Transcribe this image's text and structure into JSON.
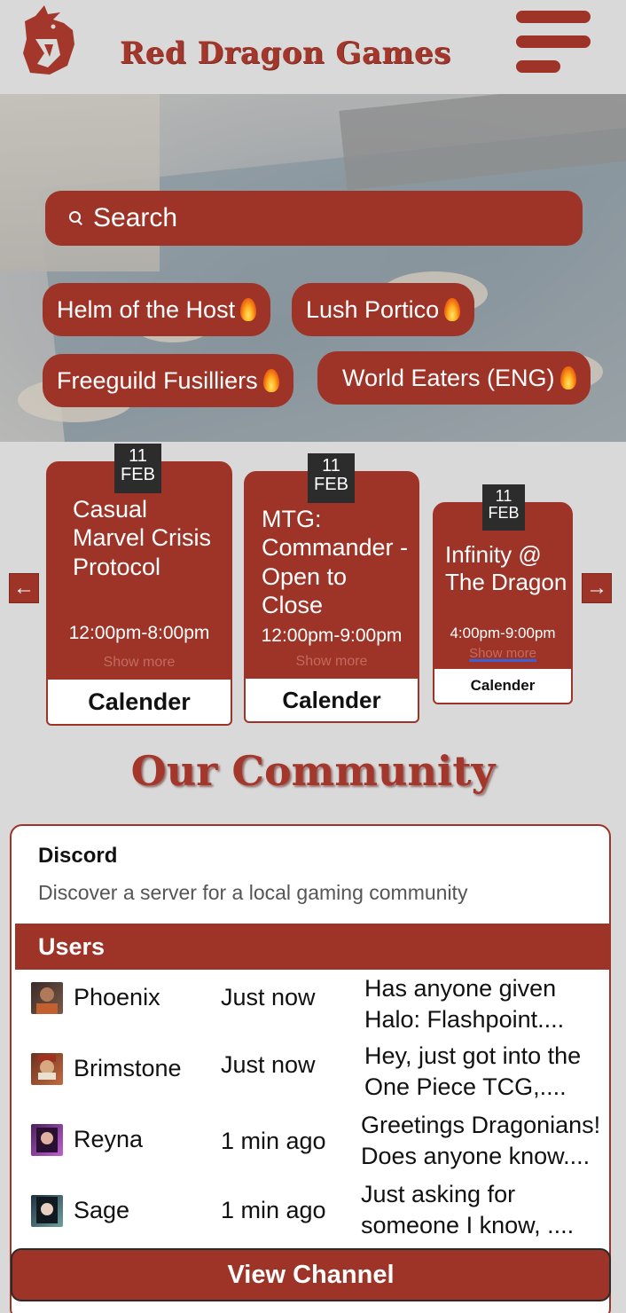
{
  "header": {
    "brand": "Red Dragon Games",
    "logo_icon": "dragon-logo-icon",
    "menu_icon": "hamburger-menu-icon"
  },
  "search": {
    "placeholder": "Search",
    "icon": "search-icon"
  },
  "tags": [
    {
      "label": "Helm of the Host",
      "icon": "fire-icon"
    },
    {
      "label": "Lush Portico ",
      "icon": "fire-icon"
    },
    {
      "label": "Freeguild Fusilliers",
      "icon": "fire-icon"
    },
    {
      "label": "World Eaters (ENG)",
      "icon": "fire-icon"
    }
  ],
  "events": {
    "prev_icon": "arrow-left-icon",
    "next_icon": "arrow-right-icon",
    "cards": [
      {
        "day": "11",
        "month": "FEB",
        "title": "Casual Marvel Crisis Protocol",
        "time": "12:00pm-8:00pm",
        "more": "Show more",
        "button": "Calender"
      },
      {
        "day": "11",
        "month": "FEB",
        "title": "MTG: Commander - Open to Close",
        "time": "12:00pm-9:00pm",
        "more": "Show more",
        "button": "Calender"
      },
      {
        "day": "11",
        "month": "FEB",
        "title": "Infinity @ The Dragon",
        "time": "4:00pm-9:00pm",
        "more": "Show more",
        "button": "Calender"
      }
    ]
  },
  "community": {
    "heading": "Our Community",
    "panel_title": "Discord",
    "panel_desc": "Discover a server for a local gaming community",
    "users_label": "Users",
    "users": [
      {
        "name": "Phoenix",
        "when": "Just now",
        "msg1": "Has anyone given",
        "msg2": "Halo: Flashpoint...."
      },
      {
        "name": "Brimstone",
        "when": "Just now",
        "msg1": "Hey, just got into the",
        "msg2": "One Piece TCG,...."
      },
      {
        "name": "Reyna",
        "when": "1 min ago",
        "msg1": "Greetings Dragonians!",
        "msg2": "Does anyone know...."
      },
      {
        "name": "Sage",
        "when": "1 min ago",
        "msg1": "Just asking for",
        "msg2": "someone I know, ...."
      }
    ],
    "view_button": "View Channel"
  },
  "colors": {
    "brand_red": "#9e3428",
    "background": "#d9d9d9",
    "date_badge": "#2c2c2c"
  }
}
